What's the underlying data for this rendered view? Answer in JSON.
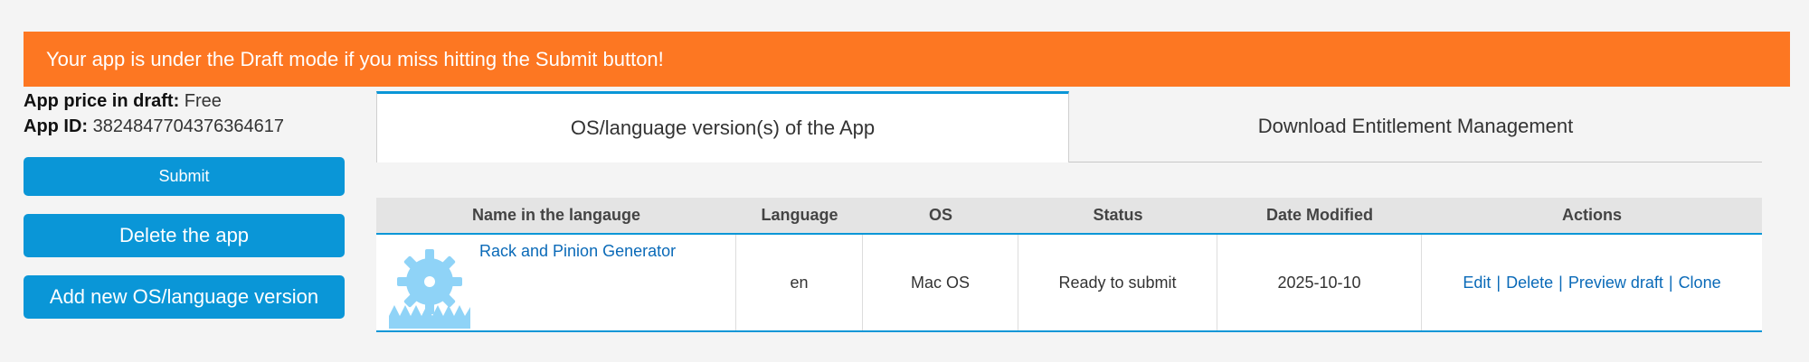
{
  "banner": {
    "message": "Your app is under the Draft mode if you miss hitting the Submit button!"
  },
  "app_info": {
    "price_label": "App price in draft:",
    "price_value": "Free",
    "id_label": "App ID:",
    "id_value": "3824847704376364617"
  },
  "buttons": {
    "submit": "Submit",
    "delete_app": "Delete the app",
    "add_version": "Add new OS/language version"
  },
  "tabs": [
    {
      "label": "OS/language version(s) of the App",
      "active": true
    },
    {
      "label": "Download Entitlement Management",
      "active": false
    }
  ],
  "table": {
    "headers": [
      "Name in the langauge",
      "Language",
      "OS",
      "Status",
      "Date Modified",
      "Actions"
    ],
    "rows": [
      {
        "name": "Rack and Pinion Generator",
        "icon": "gear-rack-icon",
        "language": "en",
        "os": "Mac OS",
        "status": "Ready to submit",
        "date_modified": "2025-10-10",
        "actions": {
          "edit": "Edit",
          "delete": "Delete",
          "preview": "Preview draft",
          "clone": "Clone",
          "separator": "|"
        }
      }
    ]
  },
  "colors": {
    "banner": "#fd7722",
    "primary": "#0a96d7",
    "link": "#0a6ab8",
    "icon": "#8fd3f7"
  }
}
